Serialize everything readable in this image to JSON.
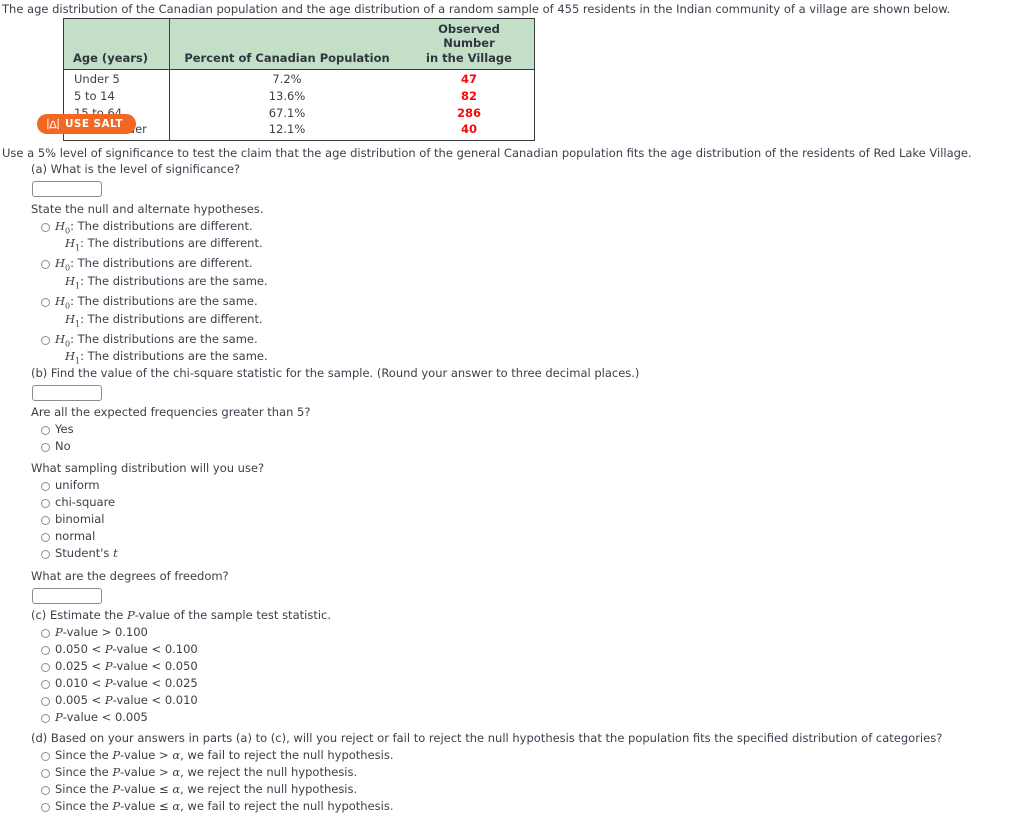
{
  "intro": "The age distribution of the Canadian population and the age distribution of a random sample of 455 residents in the Indian community of a village are shown below.",
  "table": {
    "headers": {
      "age": "Age (years)",
      "percent": "Percent of Canadian Population",
      "observed_line1": "Observed Number",
      "observed_line2": "in the Village"
    },
    "rows": [
      {
        "age": "Under 5",
        "percent": "7.2%",
        "observed": "47"
      },
      {
        "age": "5 to 14",
        "percent": "13.6%",
        "observed": "82"
      },
      {
        "age": "15 to 64",
        "percent": "67.1%",
        "observed": "286"
      },
      {
        "age": "65 and older",
        "percent": "12.1%",
        "observed": "40"
      }
    ],
    "header_bg": "#c3dfc8",
    "observed_color": "#f40b0b",
    "border_color": "#3b3b3b"
  },
  "salt": {
    "label": "USE SALT",
    "bg": "#f26722",
    "icon": "distribution-curve-icon"
  },
  "lead": "Use a 5% level of significance to test the claim that the age distribution of the general Canadian population fits the age distribution of the residents of Red Lake Village.",
  "part_a": {
    "question": "(a) What is the level of significance?",
    "input_value": "",
    "input_placeholder": ""
  },
  "hypotheses": {
    "prompt": "State the null and alternate hypotheses.",
    "options": [
      {
        "h0": ": The distributions are different.",
        "h1": ": The distributions are different."
      },
      {
        "h0": ": The distributions are different.",
        "h1": ": The distributions are the same."
      },
      {
        "h0": ": The distributions are the same.",
        "h1": ": The distributions are different."
      },
      {
        "h0": ": The distributions are the same.",
        "h1": ": The distributions are the same."
      }
    ],
    "h0_symbol": "H",
    "h0_sub": "0",
    "h1_symbol": "H",
    "h1_sub": "1"
  },
  "part_b": {
    "question": "(b) Find the value of the chi-square statistic for the sample. (Round your answer to three decimal places.)",
    "input_value": "",
    "input_placeholder": ""
  },
  "expected_freq": {
    "question": "Are all the expected frequencies greater than 5?",
    "options": [
      "Yes",
      "No"
    ]
  },
  "sampling_distribution": {
    "question": "What sampling distribution will you use?",
    "options": [
      "uniform",
      "chi-square",
      "binomial",
      "normal",
      "Student's t"
    ],
    "italic_last_char": true
  },
  "degrees_of_freedom": {
    "question": "What are the degrees of freedom?",
    "input_value": "",
    "input_placeholder": ""
  },
  "part_c": {
    "question": "(c) Estimate the P-value of the sample test statistic.",
    "options": [
      "P-value > 0.100",
      "0.050 < P-value < 0.100",
      "0.025 < P-value < 0.050",
      "0.010 < P-value < 0.025",
      "0.005 < P-value < 0.010",
      "P-value < 0.005"
    ]
  },
  "part_d": {
    "question": "(d) Based on your answers in parts (a) to (c), will you reject or fail to reject the null hypothesis that the population fits the specified distribution of categories?",
    "options": [
      "Since the P-value > α, we fail to reject the null hypothesis.",
      "Since the P-value > α, we reject the null hypothesis.",
      "Since the P-value ≤ α, we reject the null hypothesis.",
      "Since the P-value ≤ α, we fail to reject the null hypothesis."
    ]
  }
}
